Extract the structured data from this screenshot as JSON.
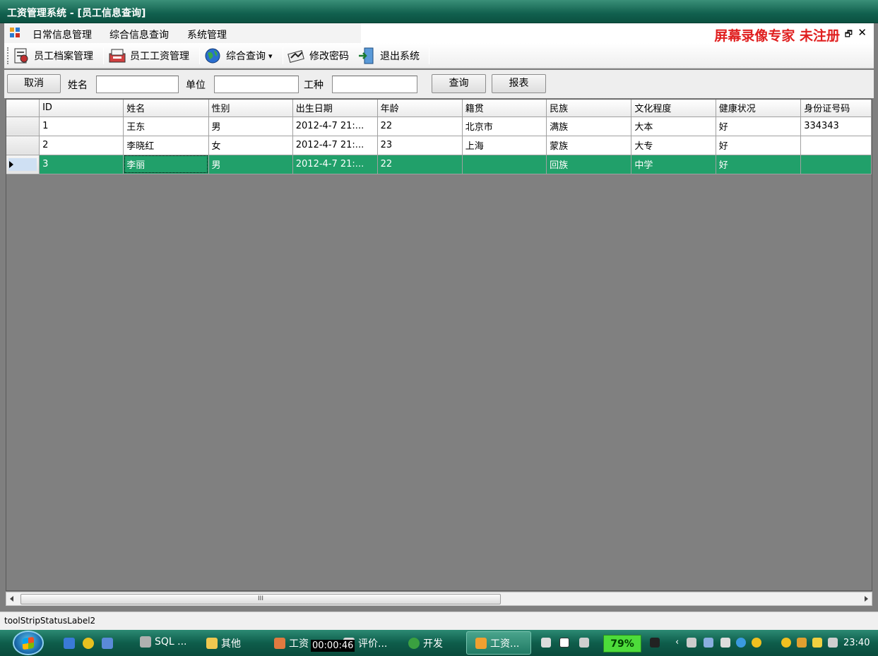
{
  "window": {
    "title": "工资管理系统 - [员工信息查询]"
  },
  "menu": {
    "items": [
      "日常信息管理",
      "综合信息查询",
      "系统管理"
    ],
    "watermark": "屏幕录像专家  未注册",
    "restore_glyph": "🗗",
    "close_glyph": "✕"
  },
  "toolbar": {
    "buttons": [
      {
        "label": "员工档案管理",
        "icon": "employee-file-icon"
      },
      {
        "label": "员工工资管理",
        "icon": "salary-icon"
      },
      {
        "label": "综合查询",
        "icon": "globe-icon"
      },
      {
        "label": "修改密码",
        "icon": "password-icon"
      },
      {
        "label": "退出系统",
        "icon": "exit-icon"
      }
    ],
    "dropdown_glyph": "▾"
  },
  "search": {
    "cancel_label": "取消",
    "name_label": "姓名",
    "name_value": "",
    "unit_label": "单位",
    "unit_value": "",
    "job_label": "工种",
    "job_value": "",
    "query_label": "查询",
    "report_label": "报表"
  },
  "grid": {
    "columns": [
      "ID",
      "姓名",
      "性别",
      "出生日期",
      "年龄",
      "籍贯",
      "民族",
      "文化程度",
      "健康状况",
      "身份证号码"
    ],
    "rows": [
      [
        "1",
        "王东",
        "男",
        "2012-4-7 21:...",
        "22",
        "北京市",
        "满族",
        "大本",
        "好",
        "334343"
      ],
      [
        "2",
        "李晓红",
        "女",
        "2012-4-7 21:...",
        "23",
        "上海",
        "蒙族",
        "大专",
        "好",
        ""
      ],
      [
        "3",
        "李丽",
        "男",
        "2012-4-7 21:...",
        "22",
        "",
        "回族",
        "中学",
        "好",
        ""
      ]
    ],
    "selected_row": 2,
    "selection_color": "#21a06a",
    "scroll_thumb_glyph": "III"
  },
  "status": {
    "label": "toolStripStatusLabel2"
  },
  "taskbar": {
    "items": [
      {
        "label": "SQL ...",
        "icon": "hammer-icon"
      },
      {
        "label": "其他",
        "icon": "folder-icon"
      },
      {
        "label": "工资",
        "icon": "app-icon"
      },
      {
        "label": "评价...",
        "icon": "doc-icon"
      },
      {
        "label": "开发",
        "icon": "tree-icon"
      },
      {
        "label": "工资...",
        "icon": "window-icon"
      }
    ],
    "timer": "00:00:46",
    "battery": "79%",
    "clock": "23:40"
  }
}
